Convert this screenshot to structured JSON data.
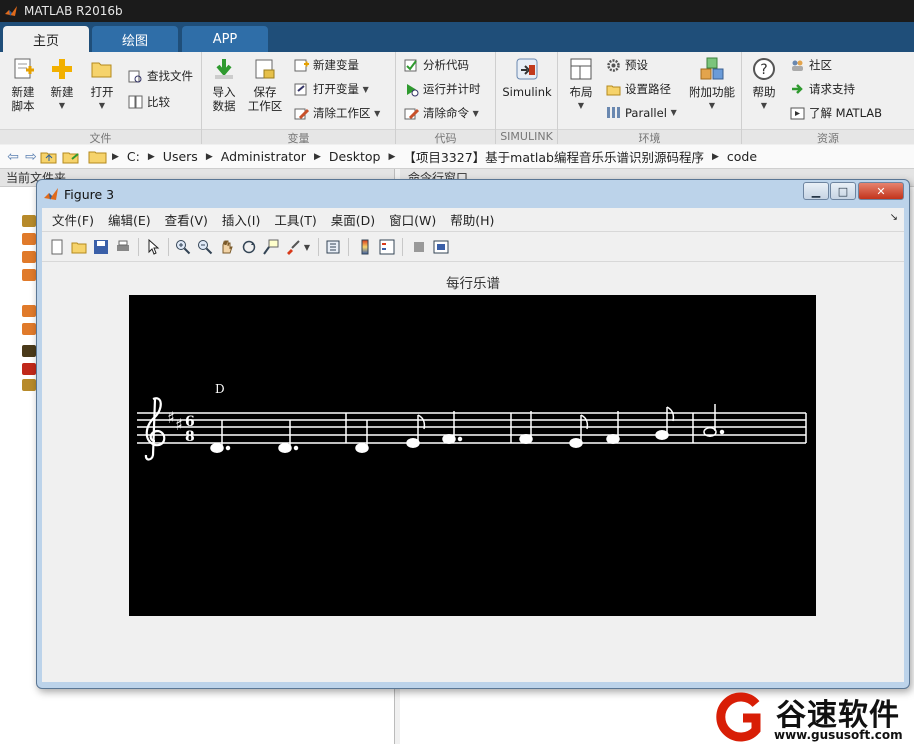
{
  "window": {
    "title": "MATLAB R2016b"
  },
  "tabs": [
    {
      "label": "主页",
      "active": true
    },
    {
      "label": "绘图",
      "active": false
    },
    {
      "label": "APP",
      "active": false
    }
  ],
  "ribbon": {
    "file": {
      "group_label": "文件",
      "new_script": "新建\n脚本",
      "new": "新建",
      "open": "打开",
      "find_files": "查找文件",
      "compare": "比较"
    },
    "variable": {
      "group_label": "变量",
      "import_data": "导入\n数据",
      "save_workspace": "保存\n工作区",
      "new_variable": "新建变量",
      "open_variable": "打开变量",
      "clear_workspace": "清除工作区"
    },
    "code": {
      "group_label": "代码",
      "analyze_code": "分析代码",
      "run_and_time": "运行并计时",
      "clear_commands": "清除命令"
    },
    "simulink": {
      "group_label": "SIMULINK",
      "simulink": "Simulink"
    },
    "environment": {
      "group_label": "环境",
      "layout": "布局",
      "preferences": "预设",
      "set_path": "设置路径",
      "parallel": "Parallel",
      "addons": "附加功能"
    },
    "resources": {
      "group_label": "资源",
      "help": "帮助",
      "community": "社区",
      "request_support": "请求支持",
      "learn_matlab": "了解 MATLAB"
    }
  },
  "address": {
    "crumbs": [
      "C:",
      "Users",
      "Administrator",
      "Desktop",
      "【项目3327】基于matlab编程音乐乐谱识别源码程序",
      "code"
    ]
  },
  "panels": {
    "current_folder": "当前文件夹",
    "command_window": "命令行窗口"
  },
  "figure": {
    "title": "Figure 3",
    "menus": [
      "文件(F)",
      "编辑(E)",
      "查看(V)",
      "插入(I)",
      "工具(T)",
      "桌面(D)",
      "窗口(W)",
      "帮助(H)"
    ],
    "axes_title": "每行乐谱",
    "score_background": "#000000",
    "score_foreground": "#ffffff",
    "toolbar_icons": [
      "new-figure-icon",
      "open-icon",
      "save-icon",
      "print-icon",
      "pointer-icon",
      "zoom-in-icon",
      "zoom-out-icon",
      "pan-hand-icon",
      "rotate-3d-icon",
      "data-cursor-icon",
      "brush-icon",
      "link-plot-icon",
      "colorbar-icon",
      "legend-icon",
      "hide-plot-tools-icon",
      "show-plot-tools-icon"
    ]
  },
  "watermark": {
    "name": "谷速软件",
    "url": "www.gususoft.com",
    "accent": "#d81e06"
  }
}
